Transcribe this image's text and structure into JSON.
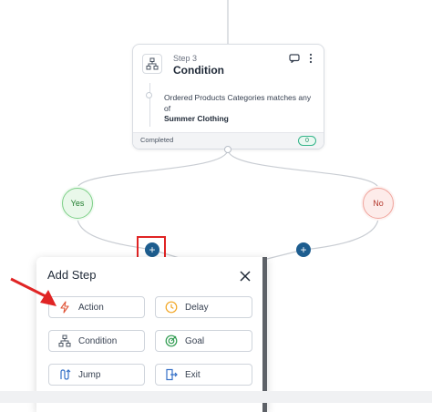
{
  "step_card": {
    "step_number": "Step 3",
    "title": "Condition",
    "condition_text": "Ordered Products Categories matches any of",
    "condition_value": "Summer Clothing",
    "status": "Completed",
    "count": "0",
    "icon": "condition-tree-icon"
  },
  "branches": {
    "yes_label": "Yes",
    "no_label": "No"
  },
  "add_buttons": {
    "left_label": "+",
    "right_label": "+"
  },
  "add_step_panel": {
    "title": "Add Step",
    "options": [
      {
        "label": "Action",
        "icon": "lightning-icon",
        "icon_color": "#e0573a"
      },
      {
        "label": "Delay",
        "icon": "clock-icon",
        "icon_color": "#f2a623"
      },
      {
        "label": "Condition",
        "icon": "condition-tree-icon",
        "icon_color": "#4b5563"
      },
      {
        "label": "Goal",
        "icon": "target-icon",
        "icon_color": "#2e9b4f"
      },
      {
        "label": "Jump",
        "icon": "jump-icon",
        "icon_color": "#3570c7"
      },
      {
        "label": "Exit",
        "icon": "exit-icon",
        "icon_color": "#3570c7"
      }
    ]
  },
  "colors": {
    "accent_blue": "#1d5d8f",
    "highlight_red": "#e02424",
    "yes_green": "#7ccf86",
    "no_red": "#f0a39b",
    "completed_badge": "#34b58a"
  }
}
